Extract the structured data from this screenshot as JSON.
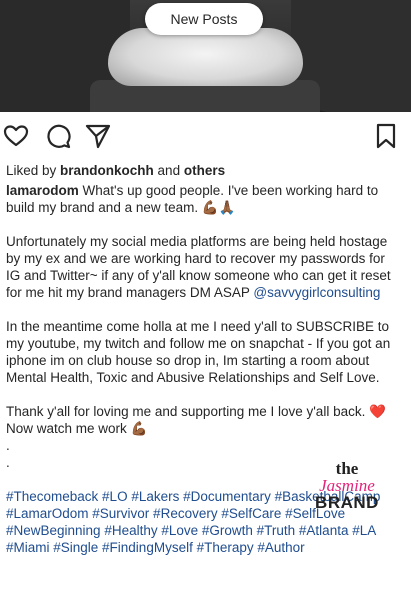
{
  "banner": {
    "new_posts": "New Posts"
  },
  "actions": {
    "like_icon": "heart-outline-icon",
    "comment_icon": "comment-bubble-icon",
    "share_icon": "paper-plane-icon",
    "save_icon": "bookmark-outline-icon"
  },
  "likes": {
    "prefix": "Liked by ",
    "user": "brandonkochh",
    "joiner": " and ",
    "others": "others"
  },
  "caption": {
    "username": "lamarodom",
    "line1": " What's up good people. I've been working hard to build my brand and a new team. 💪🏾🙏🏾",
    "para2": "Unfortunately my social media platforms are being held hostage by my ex and we are working hard to recover my passwords for IG and Twitter~ if any of y'all know someone who can get it reset for me hit my brand managers DM ASAP ",
    "mention": "@savvygirlconsulting",
    "para3": "In the meantime come holla at me I need y'all to SUBSCRIBE to my youtube, my twitch and follow me on snapchat - If you got an iphone im on club house so drop in, Im starting a room about Mental Health, Toxic and Abusive Relationships and Self Love.",
    "para4": "Thank y'all for loving me and supporting me I love y'all back. ❤️ Now watch me work 💪🏾",
    "dot1": ".",
    "dot2": ".",
    "hashtags": "#Thecomeback #LO #Lakers #Documentary #BasketballCamp #LamarOdom #Survivor #Recovery #SelfCare #SelfLove #NewBeginning #Healthy #Love #Growth #Truth #Atlanta #LA #Miami #Single #FindingMyself #Therapy #Author"
  },
  "watermark": {
    "the": "the",
    "jasmine": "Jasmine",
    "brand": "BRAND"
  },
  "colors": {
    "link": "#1f4d8f",
    "text": "#262626",
    "watermark_pink": "#e2247a"
  }
}
